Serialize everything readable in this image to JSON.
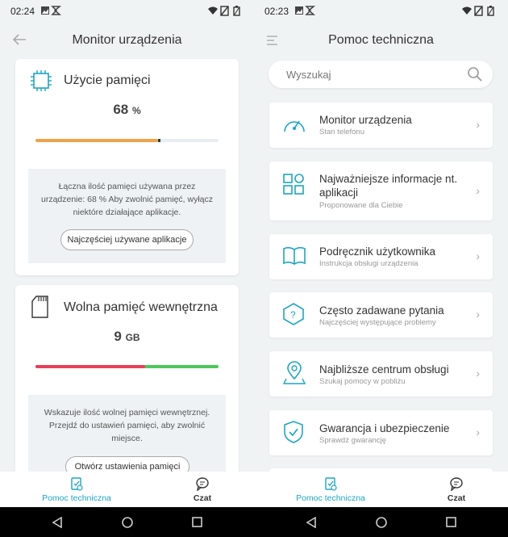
{
  "left": {
    "status": {
      "time": "02:24"
    },
    "title": "Monitor urządzenia",
    "memory_card": {
      "title": "Użycie pamięci",
      "value": "68",
      "unit": "%",
      "progress": 0.68,
      "info": "Łączna ilość pamięci używana przez urządzenie: 68 % Aby zwolnić pamięć, wyłącz niektóre działające aplikacje.",
      "button": "Najczęściej używane aplikacje"
    },
    "storage_card": {
      "title": "Wolna pamięć wewnętrzna",
      "value": "9",
      "unit": "GB",
      "used_fraction": 0.6,
      "info": "Wskazuje ilość wolnej pamięci wewnętrznej. Przejdź do ustawień pamięci, aby zwolnić miejsce.",
      "button": "Otwórz ustawienia pamięci"
    },
    "nav": {
      "support": "Pomoc techniczna",
      "chat": "Czat"
    }
  },
  "right": {
    "status": {
      "time": "02:23"
    },
    "title": "Pomoc techniczna",
    "search_placeholder": "Wyszukaj",
    "items": [
      {
        "title": "Monitor urządzenia",
        "subtitle": "Stan telefonu",
        "icon": "gauge-icon"
      },
      {
        "title": "Najważniejsze informacje nt. aplikacji",
        "subtitle": "Proponowane dla Ciebie",
        "icon": "apps-grid-icon"
      },
      {
        "title": "Podręcznik użytkownika",
        "subtitle": "Instrukcja obsługi urządzenia",
        "icon": "book-icon"
      },
      {
        "title": "Często zadawane pytania",
        "subtitle": "Najczęściej występujące problemy",
        "icon": "question-hexagon-icon"
      },
      {
        "title": "Najbliższe centrum obsługi",
        "subtitle": "Szukaj pomocy w pobliżu",
        "icon": "location-pin-icon"
      },
      {
        "title": "Gwarancja i ubezpieczenie",
        "subtitle": "Sprawdź gwarancję",
        "icon": "shield-check-icon"
      }
    ],
    "nav": {
      "support": "Pomoc techniczna",
      "chat": "Czat"
    }
  },
  "colors": {
    "accent": "#1aa6c6",
    "memory_bar": "#f0a24a",
    "storage_used": "#e8405a",
    "storage_free": "#4cc85a"
  }
}
